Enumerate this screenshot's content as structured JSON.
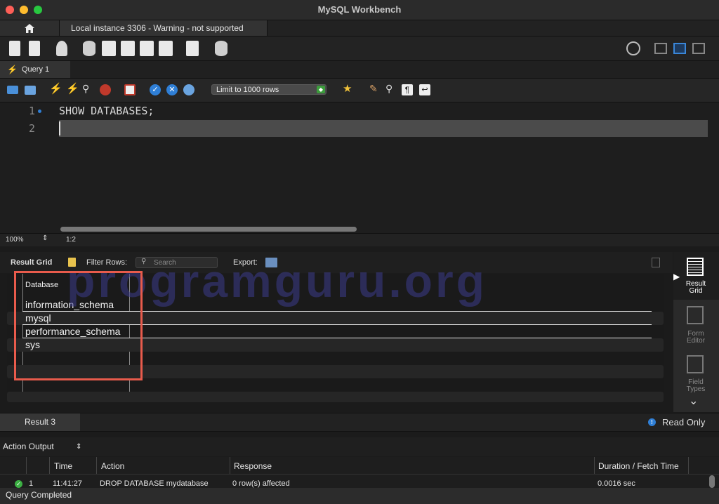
{
  "window": {
    "title": "MySQL Workbench"
  },
  "tabs": {
    "connection": "Local instance 3306 - Warning - not supported"
  },
  "query_tab": {
    "label": "Query 1"
  },
  "sql_toolbar": {
    "limit": "Limit to 1000 rows"
  },
  "editor": {
    "lines": [
      {
        "num": "1",
        "text": "SHOW DATABASES;"
      },
      {
        "num": "2",
        "text": ""
      }
    ],
    "zoom": "100%",
    "cursor": "1:2"
  },
  "result": {
    "grid_label": "Result Grid",
    "filter_label": "Filter Rows:",
    "search_placeholder": "Search",
    "export_label": "Export:",
    "column": "Database",
    "rows": [
      "information_schema",
      "mysql",
      "performance_schema",
      "sys"
    ],
    "tab": "Result 3",
    "read_only": "Read Only"
  },
  "side_panel": {
    "result_grid": "Result Grid",
    "form_editor": "Form Editor",
    "field_types": "Field Types"
  },
  "output": {
    "selector": "Action Output",
    "headers": {
      "time": "Time",
      "action": "Action",
      "response": "Response",
      "duration": "Duration / Fetch Time"
    },
    "row": {
      "num": "1",
      "time": "11:41:27",
      "action": "DROP DATABASE mydatabase",
      "response": "0 row(s) affected",
      "duration": "0.0016 sec"
    }
  },
  "status": {
    "text": "Query Completed"
  },
  "watermark": "programguru.org",
  "colors": {
    "highlight": "#e85b4c",
    "accent": "#2f7fd6",
    "success": "#3cb043"
  }
}
